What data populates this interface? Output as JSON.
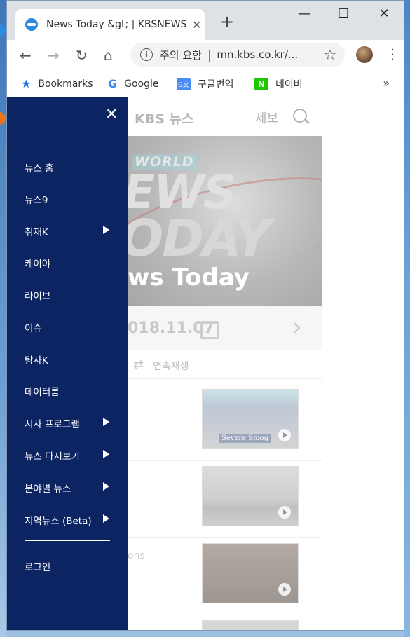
{
  "browser": {
    "tab_title": "News Today &gt; | KBSNEWS",
    "tab_close": "✕",
    "new_tab": "+",
    "window_controls": {
      "minimize": "—",
      "maximize": "☐",
      "close": "✕"
    },
    "nav": {
      "back": "←",
      "forward": "→",
      "reload": "↻",
      "home": "⌂"
    },
    "omnibox": {
      "security_text": "주의 요함",
      "separator": "|",
      "url": "mn.kbs.co.kr/...",
      "info_glyph": "i",
      "star": "☆"
    },
    "menu_glyph": "⋮",
    "bookmarks": [
      {
        "label": "Bookmarks",
        "icon": "star-icon",
        "glyph": "★",
        "color": "#1a73e8"
      },
      {
        "label": "Google",
        "icon": "google-icon",
        "glyph": "G",
        "color": "#4285f4"
      },
      {
        "label": "구글번역",
        "icon": "translate-icon",
        "glyph": "G文",
        "color": "#4a8af4"
      },
      {
        "label": "네이버",
        "icon": "naver-icon",
        "glyph": "N",
        "color": "#1ec800"
      }
    ],
    "bookmarks_more": "»"
  },
  "site": {
    "logo": "KBS 뉴스",
    "report": "제보",
    "hero": {
      "world": "WORLD",
      "line1": "EWS",
      "line2": "ODAY",
      "caption": "ws Today"
    },
    "date": "018.11.07",
    "date_next": "›",
    "replay": {
      "icon": "⇄",
      "label": "연속재생"
    },
    "rows": [
      {
        "text": "",
        "thumb_label": "Severe Smog"
      },
      {
        "text": "",
        "thumb_label": ""
      },
      {
        "text": "ons",
        "thumb_label": ""
      }
    ]
  },
  "drawer": {
    "close": "✕",
    "items": [
      {
        "label": "뉴스 홈",
        "has_submenu": false
      },
      {
        "label": "뉴스9",
        "has_submenu": false
      },
      {
        "label": "취재K",
        "has_submenu": true
      },
      {
        "label": "케이야",
        "has_submenu": false
      },
      {
        "label": "라이브",
        "has_submenu": false
      },
      {
        "label": "이슈",
        "has_submenu": false
      },
      {
        "label": "탐사K",
        "has_submenu": false
      },
      {
        "label": "데이터룸",
        "has_submenu": false
      },
      {
        "label": "시사 프로그램",
        "has_submenu": true
      },
      {
        "label": "뉴스 다시보기",
        "has_submenu": true
      },
      {
        "label": "분야별 뉴스",
        "has_submenu": true
      },
      {
        "label": "지역뉴스 (Beta)",
        "has_submenu": true
      }
    ],
    "login": "로그인"
  },
  "colors": {
    "drawer_bg": "#0d2463",
    "tabbar_bg": "#dee1e6"
  }
}
